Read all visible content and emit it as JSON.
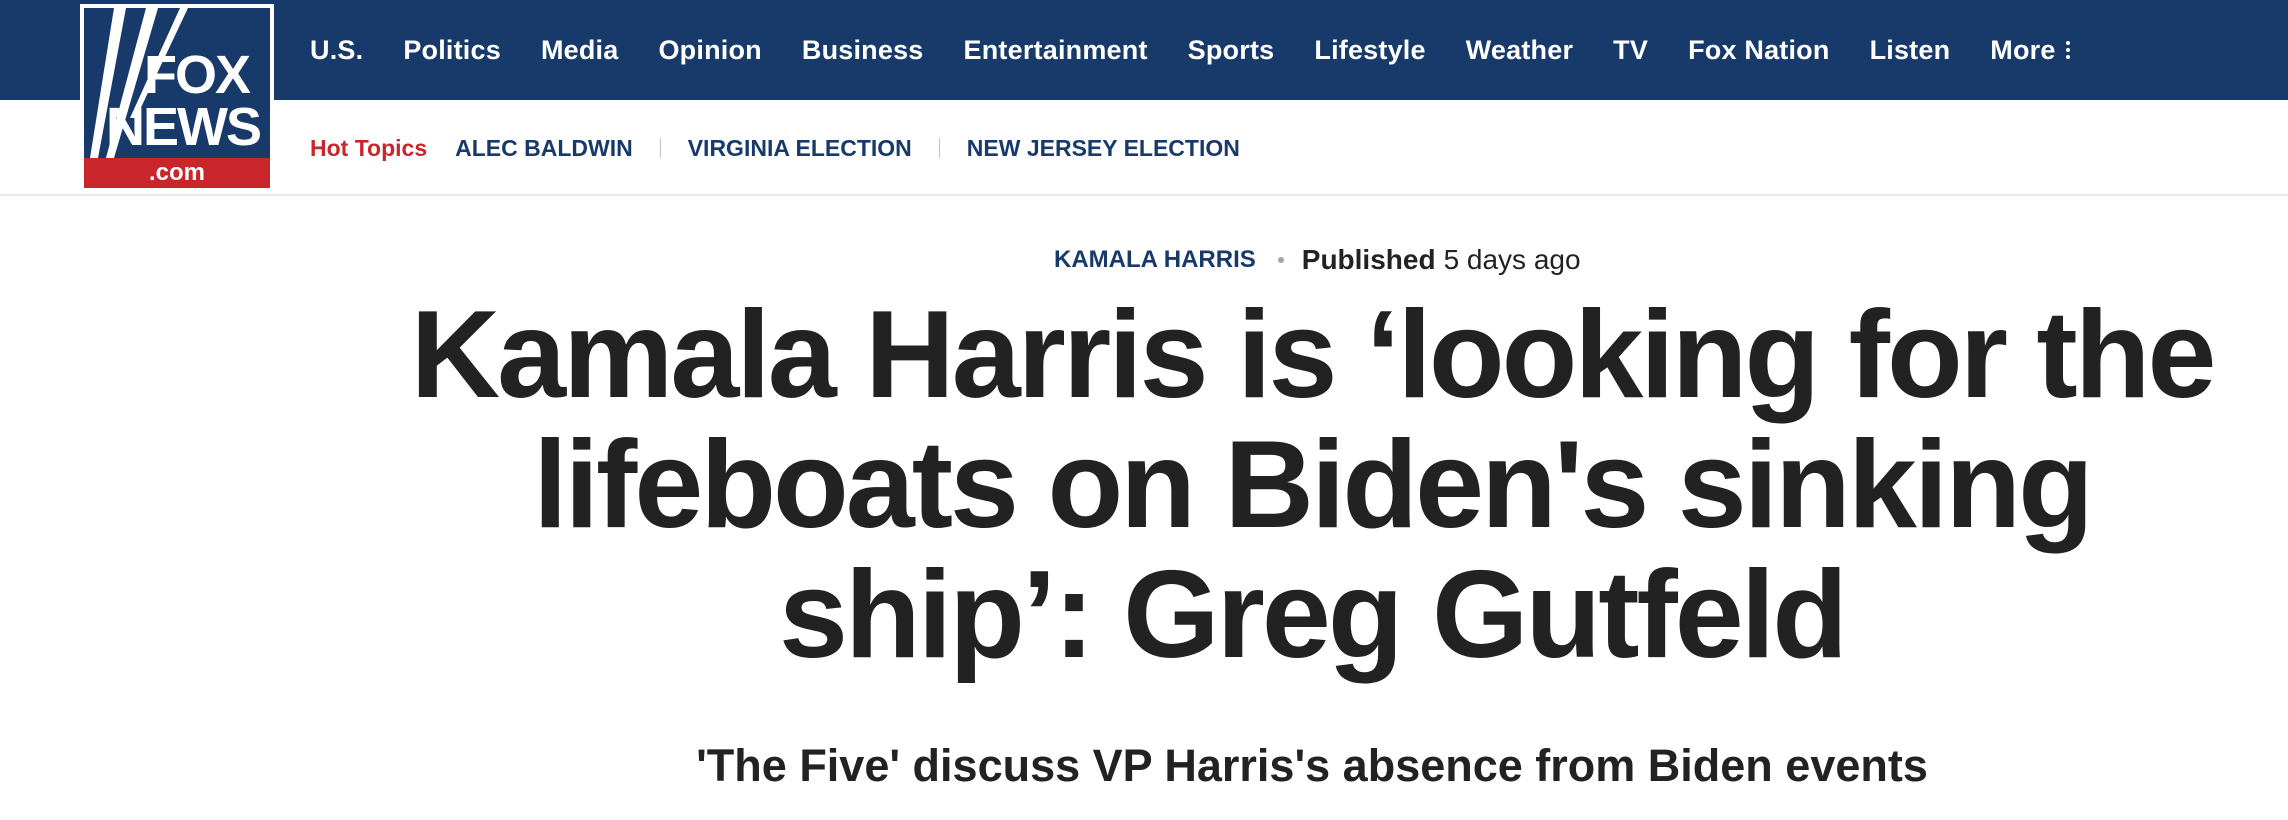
{
  "logo": {
    "line1": "FOX",
    "line2": "NEWS",
    "domain": ".com",
    "brand_blue": "#183a6a",
    "brand_red": "#c8262b"
  },
  "nav": {
    "items": [
      {
        "label": "U.S."
      },
      {
        "label": "Politics"
      },
      {
        "label": "Media"
      },
      {
        "label": "Opinion"
      },
      {
        "label": "Business"
      },
      {
        "label": "Entertainment"
      },
      {
        "label": "Sports"
      },
      {
        "label": "Lifestyle"
      },
      {
        "label": "Weather"
      },
      {
        "label": "TV"
      },
      {
        "label": "Fox Nation"
      },
      {
        "label": "Listen"
      }
    ],
    "more_label": "More",
    "more_icon": "vertical-ellipsis-icon"
  },
  "hot_topics": {
    "label": "Hot Topics",
    "items": [
      {
        "label": "ALEC BALDWIN"
      },
      {
        "label": "VIRGINIA ELECTION"
      },
      {
        "label": "NEW JERSEY ELECTION"
      }
    ]
  },
  "article": {
    "eyebrow": "KAMALA HARRIS",
    "published_label": "Published",
    "published_time": "5 days ago",
    "headline": "Kamala Harris is ‘looking for the lifeboats on Biden's sinking ship’: Greg Gutfeld",
    "subheadline": "'The Five' discuss VP Harris's absence from Biden events"
  }
}
